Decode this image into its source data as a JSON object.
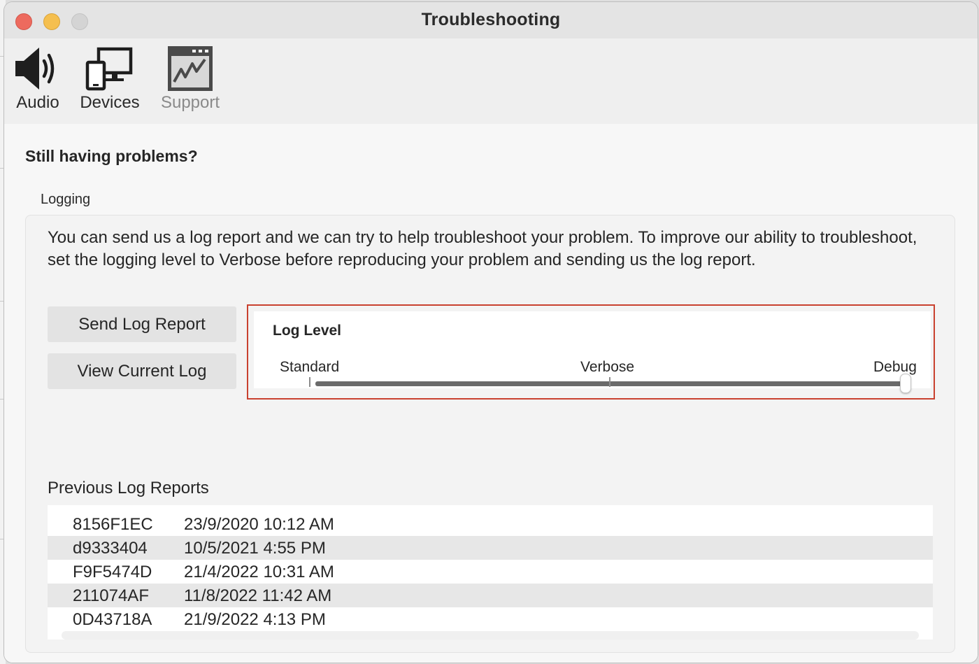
{
  "window": {
    "title": "Troubleshooting"
  },
  "toolbar": {
    "items": [
      {
        "label": "Audio",
        "icon": "speaker-icon"
      },
      {
        "label": "Devices",
        "icon": "monitor-phone-icon"
      },
      {
        "label": "Support",
        "icon": "activity-chart-icon",
        "selected": true
      }
    ]
  },
  "main": {
    "heading": "Still having problems?",
    "logging": {
      "group_label": "Logging",
      "description": "You can send us a log report and we can try to help troubleshoot your problem. To improve our ability to troubleshoot, set the logging level to Verbose before reproducing your problem and sending us the log report.",
      "send_button": "Send Log Report",
      "view_button": "View Current Log",
      "log_level": {
        "title": "Log Level",
        "levels": [
          "Standard",
          "Verbose",
          "Debug"
        ],
        "selected": "Debug",
        "highlight_color": "#c9412f"
      }
    },
    "previous": {
      "label": "Previous Log Reports",
      "rows": [
        {
          "id": "8156F1EC",
          "timestamp": "23/9/2020 10:12 AM"
        },
        {
          "id": "d9333404",
          "timestamp": "10/5/2021 4:55 PM"
        },
        {
          "id": "F9F5474D",
          "timestamp": "21/4/2022 10:31 AM"
        },
        {
          "id": "211074AF",
          "timestamp": "11/8/2022 11:42 AM"
        },
        {
          "id": "0D43718A",
          "timestamp": "21/9/2022 4:13 PM"
        }
      ]
    }
  }
}
